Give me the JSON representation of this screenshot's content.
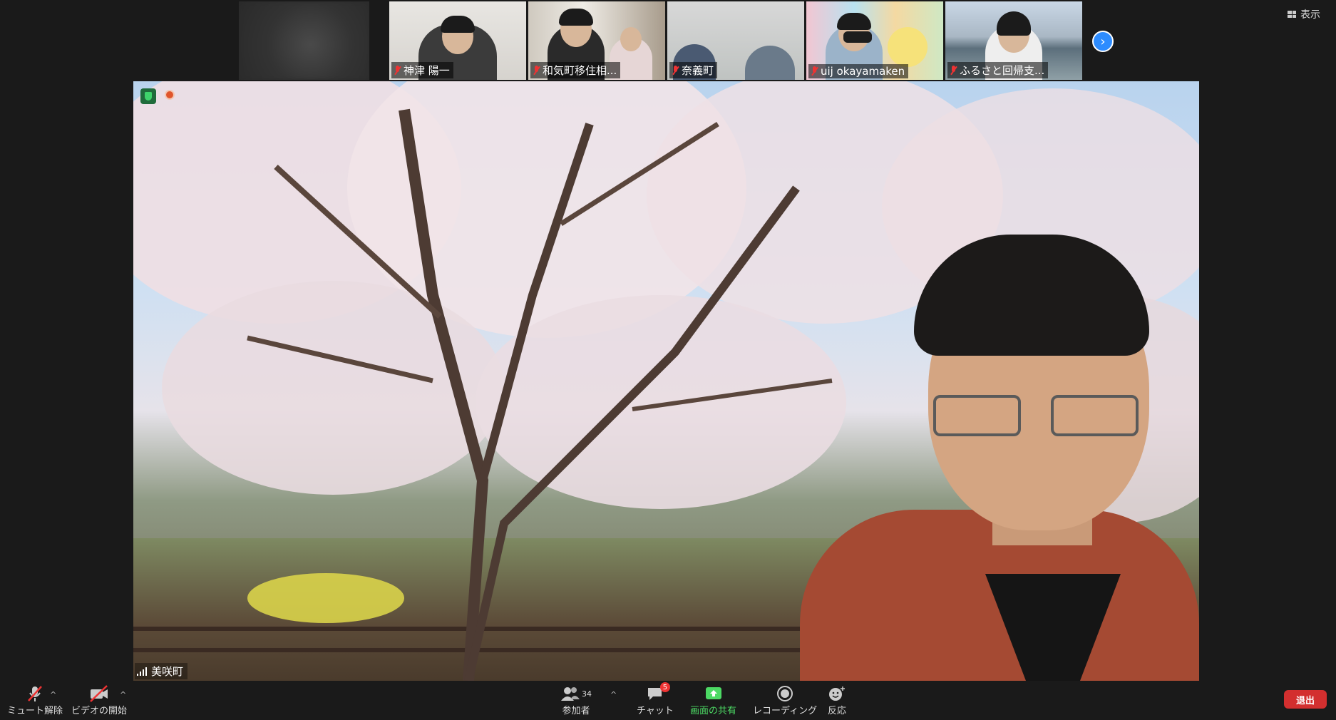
{
  "top_bar": {
    "view_label": "表示"
  },
  "participants": [
    {
      "name": "",
      "blurred": true
    },
    {
      "name": "神津 陽一"
    },
    {
      "name": "和気町移住相..."
    },
    {
      "name": "奈義町"
    },
    {
      "name": "uij okayamaken"
    },
    {
      "name": "ふるさと回帰支..."
    }
  ],
  "main_video": {
    "speaker_name": "美咲町"
  },
  "toolbar": {
    "mute_label": "ミュート解除",
    "video_label": "ビデオの開始",
    "participants_label": "参加者",
    "participants_count": "34",
    "chat_label": "チャット",
    "chat_badge": "5",
    "share_label": "画面の共有",
    "record_label": "レコーディング",
    "reactions_label": "反応",
    "leave_label": "退出"
  },
  "colors": {
    "share_green": "#4cd964",
    "leave_red": "#d32f2f",
    "next_blue": "#2d8cff"
  }
}
